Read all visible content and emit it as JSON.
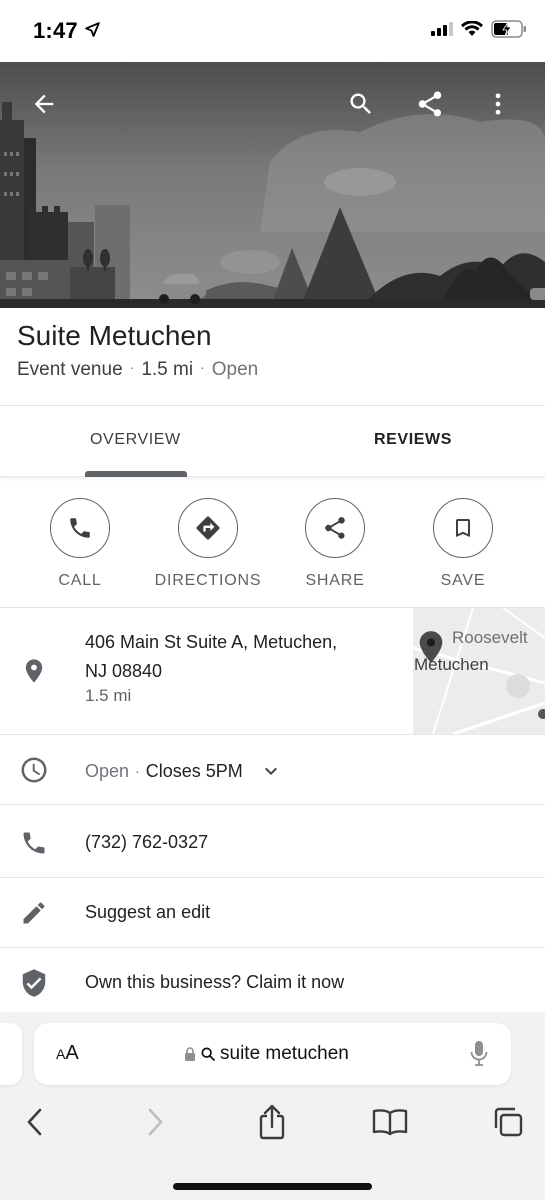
{
  "status_bar": {
    "time": "1:47",
    "icons": [
      "location-arrow-icon",
      "cellular-signal-icon",
      "wifi-icon",
      "battery-charging-icon"
    ]
  },
  "hero": {
    "buttons": [
      "back-arrow-icon",
      "search-icon",
      "share-icon",
      "more-vert-icon"
    ]
  },
  "place": {
    "title": "Suite Metuchen",
    "category": "Event venue",
    "distance": "1.5 mi",
    "status": "Open",
    "separator": "·"
  },
  "tabs": [
    {
      "label": "OVERVIEW",
      "selected": true
    },
    {
      "label": "REVIEWS",
      "selected": false
    }
  ],
  "actions": [
    {
      "label": "CALL",
      "icon": "phone-icon"
    },
    {
      "label": "DIRECTIONS",
      "icon": "directions-icon"
    },
    {
      "label": "SHARE",
      "icon": "share-icon"
    },
    {
      "label": "SAVE",
      "icon": "bookmark-icon"
    }
  ],
  "address": {
    "line1": "406 Main St Suite A, Metuchen,",
    "line2": "NJ 08840",
    "distance": "1.5 mi",
    "map_label_1": "Roosevelt",
    "map_label_2": "Metuchen"
  },
  "hours": {
    "status": "Open",
    "separator": "·",
    "closes": "Closes 5PM"
  },
  "phone": "(732) 762-0327",
  "suggest_edit": "Suggest an edit",
  "claim": "Own this business? Claim it now",
  "safari": {
    "aa_label": "AA",
    "url_text": "suite metuchen",
    "toolbar": [
      "back-icon",
      "forward-icon",
      "share-icon",
      "bookmarks-icon",
      "tabs-icon"
    ]
  }
}
